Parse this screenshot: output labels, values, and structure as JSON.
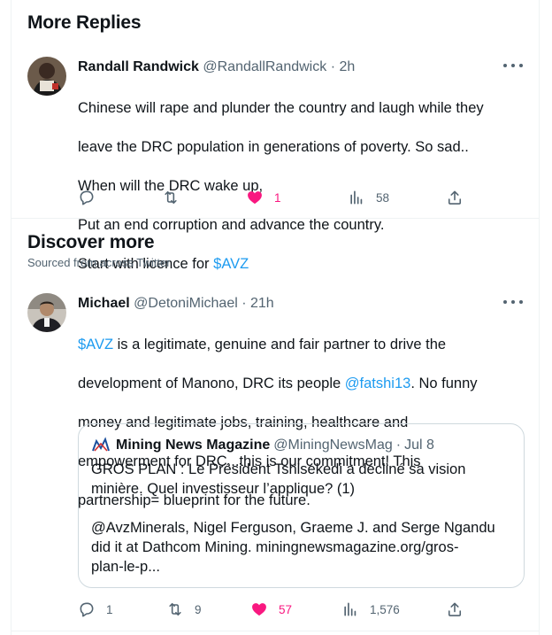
{
  "more_replies": {
    "title": "More Replies",
    "tweet": {
      "name": "Randall Randwick",
      "handle": "@RandallRandwick",
      "sep": "·",
      "time": "2h",
      "lines": [
        "Chinese will rape and plunder the country and laugh while they",
        "leave the DRC population in generations of  poverty.   So sad..",
        "When will the DRC wake up,",
        "Put an end corruption and advance the country.",
        "Start with licence for "
      ],
      "cashtag": "$AVZ",
      "actions": {
        "replies": "",
        "retweets": "",
        "likes": "1",
        "views": "58"
      }
    }
  },
  "discover": {
    "title": "Discover more",
    "subtitle": "Sourced from across Twitter",
    "tweet": {
      "name": "Michael",
      "handle": "@DetoniMichael",
      "sep": "·",
      "time": "21h",
      "cashtag": "$AVZ",
      "text_1": " is a legitimate, genuine and fair partner to drive the",
      "text_2": "development of Manono, DRC its people ",
      "mention": "@fatshi13",
      "text_3": ". No funny",
      "text_4": "money and legitimate jobs, training, healthcare and",
      "text_5": "empowerment for DRC...this is our commitment! This",
      "text_6": "partnership= blueprint for the future.",
      "quote": {
        "name": "Mining News Magazine",
        "handle": "@MiningNewsMag",
        "sep": "·",
        "time": "Jul 8",
        "text": "GROS PLAN : Le Président Tshisekedi a décliné sa vision\nminière. Quel investisseur l’applique? (1)\n\n@AvzMinerals, Nigel Ferguson, Graeme J. and Serge Ngandu\ndid it at Dathcom Mining. miningnewsmagazine.org/gros-\nplan-le-p..."
      },
      "actions": {
        "replies": "1",
        "retweets": "9",
        "likes": "57",
        "views": "1,576"
      }
    }
  },
  "colors": {
    "accent": "#1d9bf0",
    "like": "#f91880",
    "muted": "#536471",
    "text": "#0f1419"
  },
  "icons": [
    "more-icon",
    "reply-icon",
    "retweet-icon",
    "heart-icon",
    "views-icon",
    "share-icon",
    "mining-news-logo"
  ]
}
